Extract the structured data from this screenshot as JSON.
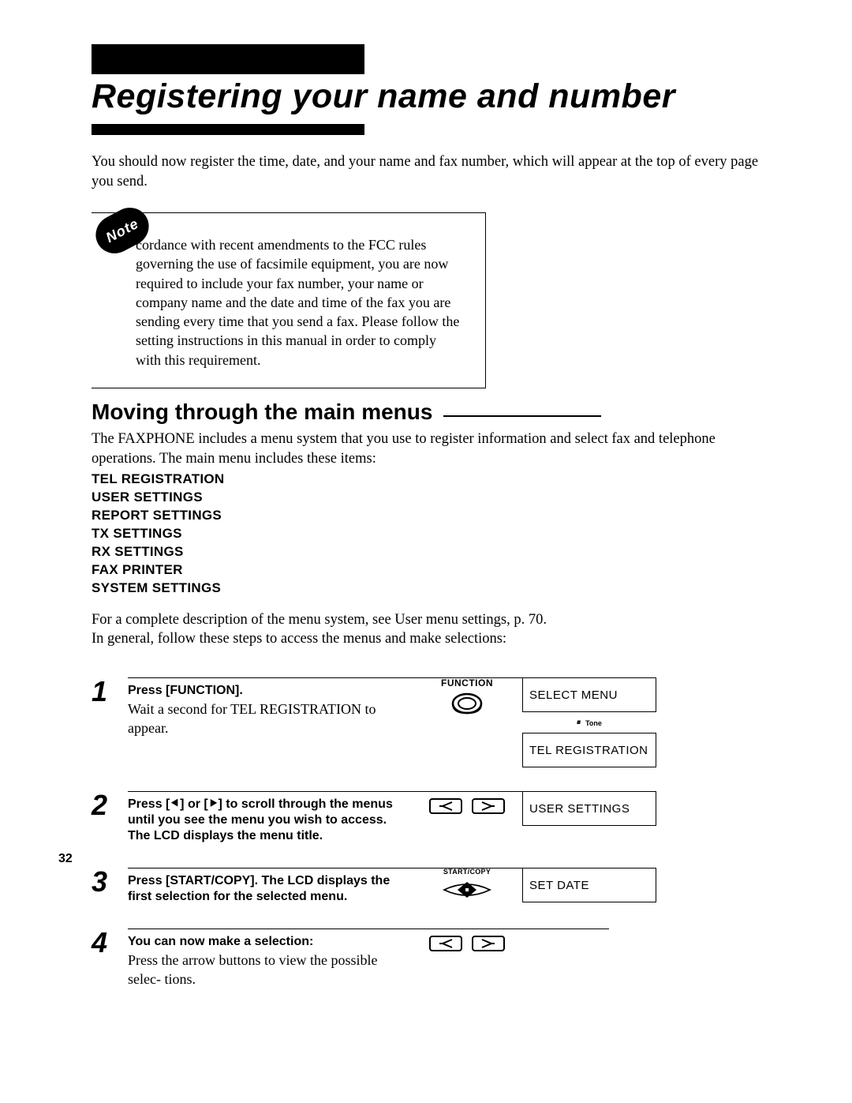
{
  "page_number": "32",
  "title": "Registering your name and number",
  "intro": "You should now register the time, date, and your name and fax number, which will appear at the top of every page you send.",
  "note_label": "Note",
  "note_text": "cordance with recent amendments to the FCC rules governing the use of facsimile equipment, you are now required to include your fax number, your name or company name and the date and time of the fax you are sending every time that you send a fax. Please follow the setting instructions in this manual in order to comply with this requirement.",
  "section_heading": "Moving through the main menus",
  "section_intro": "The FAXPHONE includes a menu system that you use to register information and select fax and telephone operations. The main menu includes these items:",
  "menu_items": [
    "TEL REGISTRATION",
    "USER SETTINGS",
    "REPORT SETTINGS",
    "TX SETTINGS",
    "RX SETTINGS",
    "FAX PRINTER",
    "SYSTEM SETTINGS"
  ],
  "section_outro1": "For a complete description of the menu system, see User menu settings, p. 70.",
  "section_outro2": "In general, follow these steps to access the menus and make selections:",
  "steps": {
    "s1": {
      "num": "1",
      "bold": "Press [FUNCTION].",
      "body": "Wait a second for TEL REGISTRATION to appear.",
      "btn_label": "FUNCTION",
      "lcd1": "SELECT MENU",
      "lcd_label": "Tone",
      "lcd2": "TEL REGISTRATION"
    },
    "s2": {
      "num": "2",
      "bold": "Press [⯇] or [⯈]  to scroll through the menus until you see the menu you wish to access. The LCD displays the menu title.",
      "lcd": "USER SETTINGS"
    },
    "s3": {
      "num": "3",
      "bold": "Press [START/COPY]. The LCD displays the first selection for the selected menu.",
      "btn_label_top": "START/COPY",
      "lcd": "SET DATE"
    },
    "s4": {
      "num": "4",
      "bold": "You can now make a selection:",
      "body": "Press the arrow buttons to view the possible selec- tions."
    }
  }
}
